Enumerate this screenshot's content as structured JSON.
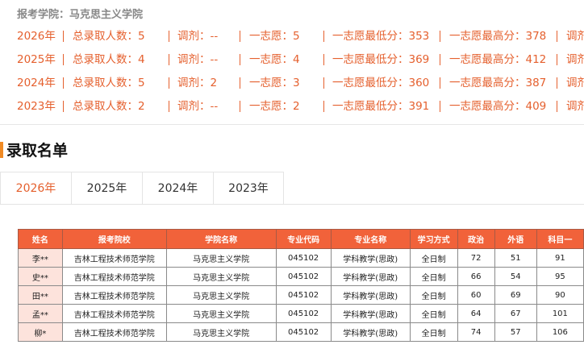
{
  "summary": {
    "header": "报考学院：马克思主义学院",
    "rows": [
      {
        "year": "2026年",
        "total": "总录取人数：5",
        "adjust": "调剂：--",
        "first_choice": "一志愿：5",
        "min_score": "一志愿最低分：353",
        "max_score": "一志愿最高分：378",
        "tail": "调剂"
      },
      {
        "year": "2025年",
        "total": "总录取人数：4",
        "adjust": "调剂：--",
        "first_choice": "一志愿：4",
        "min_score": "一志愿最低分：369",
        "max_score": "一志愿最高分：412",
        "tail": "调剂"
      },
      {
        "year": "2024年",
        "total": "总录取人数：5",
        "adjust": "调剂：2",
        "first_choice": "一志愿：3",
        "min_score": "一志愿最低分：360",
        "max_score": "一志愿最高分：387",
        "tail": "调剂"
      },
      {
        "year": "2023年",
        "total": "总录取人数：2",
        "adjust": "调剂：--",
        "first_choice": "一志愿：2",
        "min_score": "一志愿最低分：391",
        "max_score": "一志愿最高分：409",
        "tail": "调剂"
      }
    ]
  },
  "section_title": "录取名单",
  "tabs": [
    "2026年",
    "2025年",
    "2024年",
    "2023年"
  ],
  "active_tab": "2026年",
  "table": {
    "headers": [
      "姓名",
      "报考院校",
      "学院名称",
      "专业代码",
      "专业名称",
      "学习方式",
      "政治",
      "外语",
      "科目一"
    ],
    "rows": [
      [
        "李**",
        "吉林工程技术师范学院",
        "马克思主义学院",
        "045102",
        "学科教学(思政)",
        "全日制",
        "72",
        "51",
        "91"
      ],
      [
        "史**",
        "吉林工程技术师范学院",
        "马克思主义学院",
        "045102",
        "学科教学(思政)",
        "全日制",
        "66",
        "54",
        "95"
      ],
      [
        "田**",
        "吉林工程技术师范学院",
        "马克思主义学院",
        "045102",
        "学科教学(思政)",
        "全日制",
        "60",
        "69",
        "90"
      ],
      [
        "孟**",
        "吉林工程技术师范学院",
        "马克思主义学院",
        "045102",
        "学科教学(思政)",
        "全日制",
        "64",
        "67",
        "101"
      ],
      [
        "柳*",
        "吉林工程技术师范学院",
        "马克思主义学院",
        "045102",
        "学科教学(思政)",
        "全日制",
        "74",
        "57",
        "106"
      ]
    ]
  },
  "colors": {
    "accent": "#e5602e",
    "header_bg": "#f1623a",
    "name_cell_bg": "#fde3dc",
    "section_bar": "#f08a24"
  }
}
